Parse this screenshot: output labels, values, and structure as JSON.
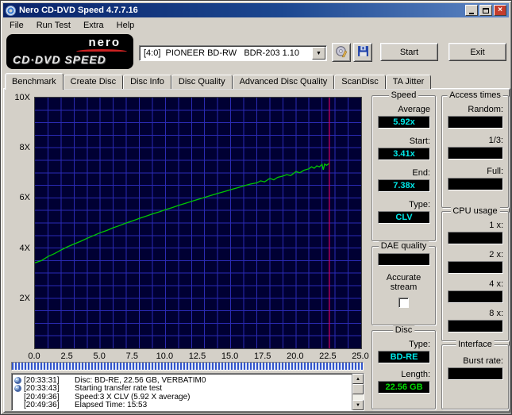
{
  "window": {
    "title": "Nero CD-DVD Speed 4.7.7.16"
  },
  "glyphs": {
    "close": "×",
    "dropdown_arrow": "▼",
    "scroll_up": "▲",
    "scroll_down": "▼"
  },
  "menu": {
    "items": [
      "File",
      "Run Test",
      "Extra",
      "Help"
    ]
  },
  "logo": {
    "brand": "nero",
    "product": "CD·DVD SPEED"
  },
  "toolbar": {
    "drive_value": "[4:0]  PIONEER BD-RW   BDR-203 1.10",
    "start_label": "Start",
    "exit_label": "Exit"
  },
  "tabs": {
    "items": [
      "Benchmark",
      "Create Disc",
      "Disc Info",
      "Disc Quality",
      "Advanced Disc Quality",
      "ScanDisc",
      "TA Jitter"
    ],
    "active": "Benchmark"
  },
  "chart_data": {
    "type": "line",
    "title": "",
    "xlabel": "",
    "ylabel": "",
    "background": "#000033",
    "grid_color": "#2a2ab4",
    "x_axis": {
      "min": 0,
      "max": 25,
      "minor_step": 1,
      "tick_values": [
        0,
        2.5,
        5,
        7.5,
        10,
        12.5,
        15,
        17.5,
        20,
        22.5,
        25
      ],
      "tick_labels": [
        "0.0",
        "2.5",
        "5.0",
        "7.5",
        "10.0",
        "12.5",
        "15.0",
        "17.5",
        "20.0",
        "22.5",
        "25.0"
      ]
    },
    "y_axis": {
      "min": 0,
      "max": 10,
      "minor_step": 0.5,
      "tick_values": [
        10,
        8,
        6,
        4,
        2
      ],
      "tick_labels": [
        "10X",
        "8X",
        "6X",
        "4X",
        "2X"
      ]
    },
    "marker_line": {
      "x": 22.56,
      "color": "#d40064"
    },
    "series": [
      {
        "name": "transfer-rate",
        "color": "#00c800",
        "points": [
          [
            0,
            3.41
          ],
          [
            0.5,
            3.5
          ],
          [
            1,
            3.66
          ],
          [
            1.5,
            3.78
          ],
          [
            2,
            3.92
          ],
          [
            2.5,
            4.05
          ],
          [
            3,
            4.16
          ],
          [
            3.5,
            4.27
          ],
          [
            4,
            4.39
          ],
          [
            4.5,
            4.5
          ],
          [
            5,
            4.61
          ],
          [
            5.5,
            4.7
          ],
          [
            6,
            4.81
          ],
          [
            6.5,
            4.9
          ],
          [
            7,
            5.0
          ],
          [
            7.5,
            5.09
          ],
          [
            8,
            5.18
          ],
          [
            8.5,
            5.27
          ],
          [
            9,
            5.36
          ],
          [
            9.5,
            5.44
          ],
          [
            10,
            5.53
          ],
          [
            10.5,
            5.61
          ],
          [
            11,
            5.7
          ],
          [
            11.5,
            5.78
          ],
          [
            12,
            5.86
          ],
          [
            12.5,
            5.94
          ],
          [
            13,
            6.02
          ],
          [
            13.5,
            6.1
          ],
          [
            14,
            6.18
          ],
          [
            14.5,
            6.25
          ],
          [
            15,
            6.33
          ],
          [
            15.5,
            6.4
          ],
          [
            16,
            6.48
          ],
          [
            16.5,
            6.55
          ],
          [
            17,
            6.6
          ],
          [
            17.3,
            6.68
          ],
          [
            17.6,
            6.64
          ],
          [
            18,
            6.78
          ],
          [
            18.3,
            6.72
          ],
          [
            18.6,
            6.82
          ],
          [
            19,
            6.87
          ],
          [
            19.3,
            6.93
          ],
          [
            19.6,
            6.89
          ],
          [
            20,
            7.05
          ],
          [
            20.3,
            7.0
          ],
          [
            20.6,
            7.1
          ],
          [
            21,
            7.16
          ],
          [
            21.2,
            7.24
          ],
          [
            21.4,
            7.18
          ],
          [
            21.6,
            7.28
          ],
          [
            21.8,
            7.24
          ],
          [
            22,
            7.34
          ],
          [
            22.1,
            7.12
          ],
          [
            22.2,
            7.35
          ],
          [
            22.35,
            7.3
          ],
          [
            22.56,
            7.38
          ]
        ]
      }
    ]
  },
  "progress": {
    "percent": 100
  },
  "speed_group": {
    "title": "Speed",
    "average_label": "Average",
    "average": "5.92x",
    "start_label": "Start:",
    "start": "3.41x",
    "end_label": "End:",
    "end": "7.38x",
    "type_label": "Type:",
    "type": "CLV"
  },
  "dae_group": {
    "title": "DAE quality",
    "value": "",
    "accurate_label": "Accurate stream",
    "accurate_checked": false
  },
  "access_group": {
    "title": "Access times",
    "random_label": "Random:",
    "random": "",
    "third_label": "1/3:",
    "third": "",
    "full_label": "Full:",
    "full": ""
  },
  "cpu_group": {
    "title": "CPU usage",
    "rows": [
      {
        "label": "1 x:",
        "value": ""
      },
      {
        "label": "2 x:",
        "value": ""
      },
      {
        "label": "4 x:",
        "value": ""
      },
      {
        "label": "8 x:",
        "value": ""
      }
    ]
  },
  "disc_group": {
    "title": "Disc",
    "type_label": "Type:",
    "type": "BD-RE",
    "length_label": "Length:",
    "length": "22.56 GB"
  },
  "interface_group": {
    "title": "Interface",
    "burst_label": "Burst rate:",
    "burst": ""
  },
  "log": {
    "entries": [
      {
        "icon": "disc",
        "time": "[20:33:31]",
        "text": "Disc: BD-RE, 22.56 GB, VERBATIM0"
      },
      {
        "icon": "disc",
        "time": "[20:33:43]",
        "text": "Starting transfer rate test"
      },
      {
        "icon": "",
        "time": "[20:49:36]",
        "text": "Speed:3 X CLV (5.92 X average)"
      },
      {
        "icon": "",
        "time": "[20:49:36]",
        "text": "Elapsed Time: 15:53"
      }
    ]
  }
}
